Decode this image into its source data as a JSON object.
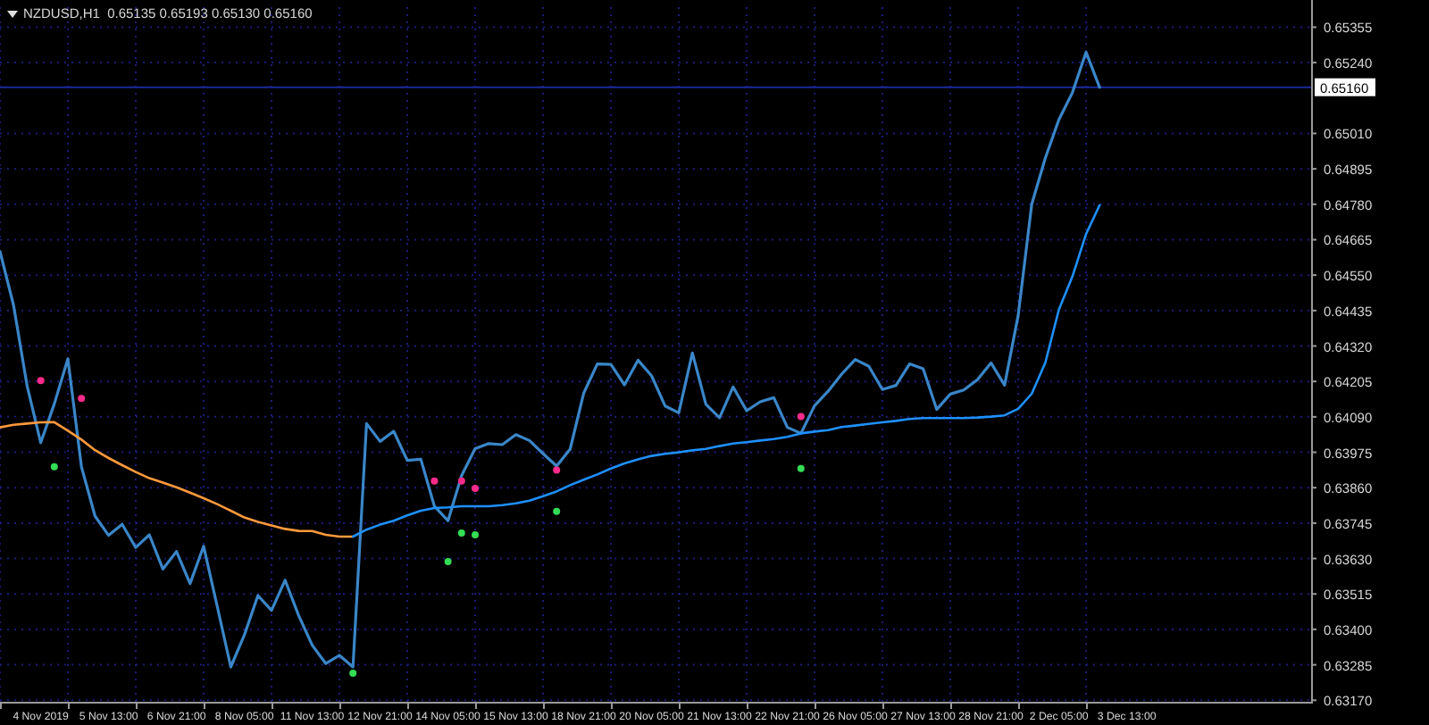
{
  "chart": {
    "header": "NZDUSD,H1  0.65135 0.65193 0.65130 0.65160",
    "chart_data": {
      "type": "line",
      "grid": true,
      "ref_lines": [
        {
          "axis": "y",
          "value": 0.6516,
          "label": "0.65160",
          "color": "#1a2a9a"
        }
      ],
      "categories": [
        null,
        null,
        null,
        "4 Nov 2019",
        null,
        null,
        null,
        null,
        "5 Nov 13:00",
        null,
        null,
        null,
        null,
        "6 Nov 21:00",
        null,
        null,
        null,
        null,
        "8 Nov 05:00",
        null,
        null,
        null,
        null,
        "11 Nov 13:00",
        null,
        null,
        null,
        null,
        "12 Nov 21:00",
        null,
        null,
        null,
        null,
        "14 Nov 05:00",
        null,
        null,
        null,
        null,
        "15 Nov 13:00",
        null,
        null,
        null,
        null,
        "18 Nov 21:00",
        null,
        null,
        null,
        null,
        "20 Nov 05:00",
        null,
        null,
        null,
        null,
        "21 Nov 13:00",
        null,
        null,
        null,
        null,
        "22 Nov 21:00",
        null,
        null,
        null,
        null,
        "26 Nov 05:00",
        null,
        null,
        null,
        null,
        "27 Nov 13:00",
        null,
        null,
        null,
        null,
        "28 Nov 21:00",
        null,
        null,
        null,
        null,
        "2 Dec 05:00",
        null,
        null,
        null,
        null,
        "3 Dec 13:00"
      ],
      "ylim": [
        0.63165,
        0.6542
      ],
      "yticks": [
        {
          "value": 0.65355,
          "label": "0.65355"
        },
        {
          "value": 0.6524,
          "label": "0.65240"
        },
        {
          "value": 0.6501,
          "label": "0.65010"
        },
        {
          "value": 0.64895,
          "label": "0.64895"
        },
        {
          "value": 0.6478,
          "label": "0.64780"
        },
        {
          "value": 0.64665,
          "label": "0.64665"
        },
        {
          "value": 0.6455,
          "label": "0.64550"
        },
        {
          "value": 0.64435,
          "label": "0.64435"
        },
        {
          "value": 0.6432,
          "label": "0.64320"
        },
        {
          "value": 0.64205,
          "label": "0.64205"
        },
        {
          "value": 0.6409,
          "label": "0.64090"
        },
        {
          "value": 0.63975,
          "label": "0.63975"
        },
        {
          "value": 0.6386,
          "label": "0.63860"
        },
        {
          "value": 0.63745,
          "label": "0.63745"
        },
        {
          "value": 0.6363,
          "label": "0.63630"
        },
        {
          "value": 0.63515,
          "label": "0.63515"
        },
        {
          "value": 0.634,
          "label": "0.63400"
        },
        {
          "value": 0.63285,
          "label": "0.63285"
        },
        {
          "value": 0.6317,
          "label": "0.63170"
        }
      ],
      "series": [
        {
          "color": "#3a86c8",
          "values": [
            0.64627,
            0.64452,
            0.6419,
            0.64006,
            0.64132,
            0.64278,
            0.63928,
            0.63768,
            0.63705,
            0.63741,
            0.63666,
            0.63707,
            0.63596,
            0.63653,
            0.63549,
            0.6367,
            0.63475,
            0.63278,
            0.63382,
            0.6351,
            0.63462,
            0.6356,
            0.63445,
            0.63349,
            0.63289,
            0.63316,
            0.63278,
            0.64068,
            0.6401,
            0.64043,
            0.63949,
            0.63952,
            0.638,
            0.63753,
            0.63899,
            0.63987,
            0.64003,
            0.64,
            0.64032,
            0.64013,
            0.63971,
            0.6393,
            0.63985,
            0.64167,
            0.64262,
            0.6426,
            0.64194,
            0.64274,
            0.64223,
            0.64125,
            0.64103,
            0.64297,
            0.64131,
            0.64087,
            0.64187,
            0.6411,
            0.64139,
            0.64152,
            0.64056,
            0.64036,
            0.64126,
            0.64173,
            0.64229,
            0.64276,
            0.64254,
            0.64179,
            0.64192,
            0.64262,
            0.64246,
            0.64114,
            0.64164,
            0.64177,
            0.64211,
            0.64265,
            0.64193,
            0.64419,
            0.6478,
            0.6493,
            0.65055,
            0.65143,
            0.65274,
            0.6516,
            null,
            null
          ]
        },
        {
          "color": "#ff9a3c",
          "values": [
            0.64056,
            0.64064,
            0.64068,
            0.64072,
            0.64073,
            0.64045,
            0.64016,
            0.63982,
            0.63956,
            0.63933,
            0.63911,
            0.63891,
            0.63877,
            0.63861,
            0.63844,
            0.63826,
            0.63807,
            0.63785,
            0.63763,
            0.63749,
            0.63737,
            0.63726,
            0.6372,
            0.63719,
            0.63707,
            0.63701,
            0.63701,
            null,
            null,
            null,
            null,
            null,
            null,
            null,
            null,
            null,
            null,
            null,
            null,
            null,
            null,
            null,
            null,
            null,
            null,
            null,
            null,
            null,
            null,
            null,
            null,
            null,
            null,
            null,
            null,
            null,
            null,
            null,
            null,
            null,
            null,
            null,
            null,
            null,
            null,
            null,
            null,
            null,
            null,
            null,
            null,
            null,
            null,
            null,
            null,
            null,
            null,
            null,
            null,
            null,
            null,
            null,
            null,
            null
          ]
        },
        {
          "color": "#1e90ff",
          "values": [
            null,
            null,
            null,
            null,
            null,
            null,
            null,
            null,
            null,
            null,
            null,
            null,
            null,
            null,
            null,
            null,
            null,
            null,
            null,
            null,
            null,
            null,
            null,
            null,
            null,
            null,
            0.63701,
            0.63724,
            0.6374,
            0.63753,
            0.6377,
            0.63785,
            0.63794,
            0.63796,
            0.638,
            0.638,
            0.638,
            0.63803,
            0.63809,
            0.63818,
            0.63832,
            0.63848,
            0.63868,
            0.63886,
            0.63903,
            0.63922,
            0.63939,
            0.63952,
            0.63963,
            0.6397,
            0.63975,
            0.63981,
            0.63986,
            0.63995,
            0.64003,
            0.64008,
            0.64013,
            0.64018,
            0.64025,
            0.64036,
            0.64042,
            0.64047,
            0.64057,
            0.64062,
            0.64067,
            0.64072,
            0.64077,
            0.64083,
            0.64086,
            0.64086,
            0.64086,
            0.64086,
            0.64088,
            0.64091,
            0.64095,
            0.64116,
            0.64165,
            0.64266,
            0.64438,
            0.64546,
            0.64683,
            0.64777,
            null,
            null
          ]
        },
        {
          "type": "scatter",
          "color": "#ff2a8a",
          "values": [
            null,
            null,
            null,
            0.64208,
            null,
            null,
            0.6415,
            null,
            null,
            null,
            null,
            null,
            null,
            null,
            null,
            null,
            null,
            null,
            null,
            null,
            null,
            null,
            null,
            null,
            null,
            null,
            null,
            null,
            null,
            null,
            null,
            null,
            0.63882,
            null,
            0.63882,
            0.63858,
            null,
            null,
            null,
            null,
            null,
            0.63917,
            null,
            null,
            null,
            null,
            null,
            null,
            null,
            null,
            null,
            null,
            null,
            null,
            null,
            null,
            null,
            null,
            null,
            0.64091,
            null,
            null,
            null,
            null,
            null,
            null,
            null,
            null,
            null,
            null,
            null,
            null,
            null,
            null,
            null,
            null,
            null,
            null,
            null,
            null,
            null,
            null,
            null,
            null
          ]
        },
        {
          "type": "scatter",
          "color": "#33dd55",
          "values": [
            null,
            null,
            null,
            null,
            0.63928,
            null,
            null,
            null,
            null,
            null,
            null,
            null,
            null,
            null,
            null,
            null,
            null,
            null,
            null,
            null,
            null,
            null,
            null,
            null,
            null,
            null,
            0.63258,
            null,
            null,
            null,
            null,
            null,
            null,
            0.6362,
            0.63713,
            0.63707,
            null,
            null,
            null,
            null,
            null,
            0.63783,
            null,
            null,
            null,
            null,
            null,
            null,
            null,
            null,
            null,
            null,
            null,
            null,
            null,
            null,
            null,
            null,
            null,
            0.63922,
            null,
            null,
            null,
            null,
            null,
            null,
            null,
            null,
            null,
            null,
            null,
            null,
            null,
            null,
            null,
            null,
            null,
            null,
            null,
            null,
            null,
            null,
            null,
            null
          ]
        }
      ]
    }
  }
}
